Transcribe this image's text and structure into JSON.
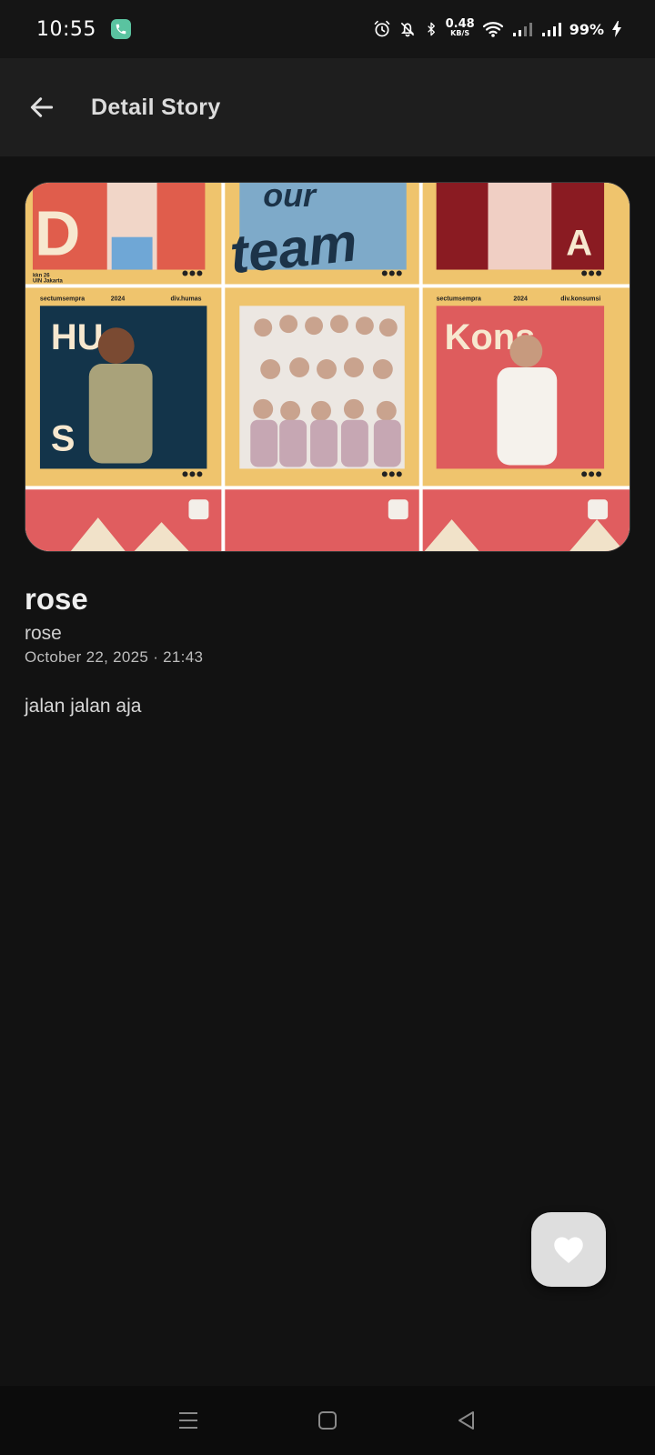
{
  "status_bar": {
    "time": "10:55",
    "net_speed_value": "0.48",
    "net_speed_unit": "KB/S",
    "battery": "99%"
  },
  "app_bar": {
    "title": "Detail Story",
    "back_icon": "arrow-back-icon"
  },
  "story": {
    "image_alt": "story-photo",
    "author_name": "rose",
    "username": "rose",
    "timestamp": "October 22, 2025 · 21:43",
    "description": "jalan jalan aja"
  },
  "image_text": {
    "our": "our",
    "team": "team",
    "kkn": "kkn 26",
    "uin": "UIN Jakarta",
    "group": "sectumsempra",
    "year": "2024",
    "div_humas": "div.humas",
    "div_konsumsi": "div.konsumsi",
    "hu": "HU",
    "s": "S",
    "kons": "Kons",
    "d_letter": "D",
    "a_letter": "A"
  },
  "fab": {
    "icon": "heart-icon"
  },
  "nav": {
    "menu_icon": "menu-icon",
    "home_icon": "home-icon",
    "back_icon": "back-triangle-icon"
  },
  "colors": {
    "background": "#121212",
    "app_bar": "#1e1e1e",
    "fab": "#dedede"
  }
}
